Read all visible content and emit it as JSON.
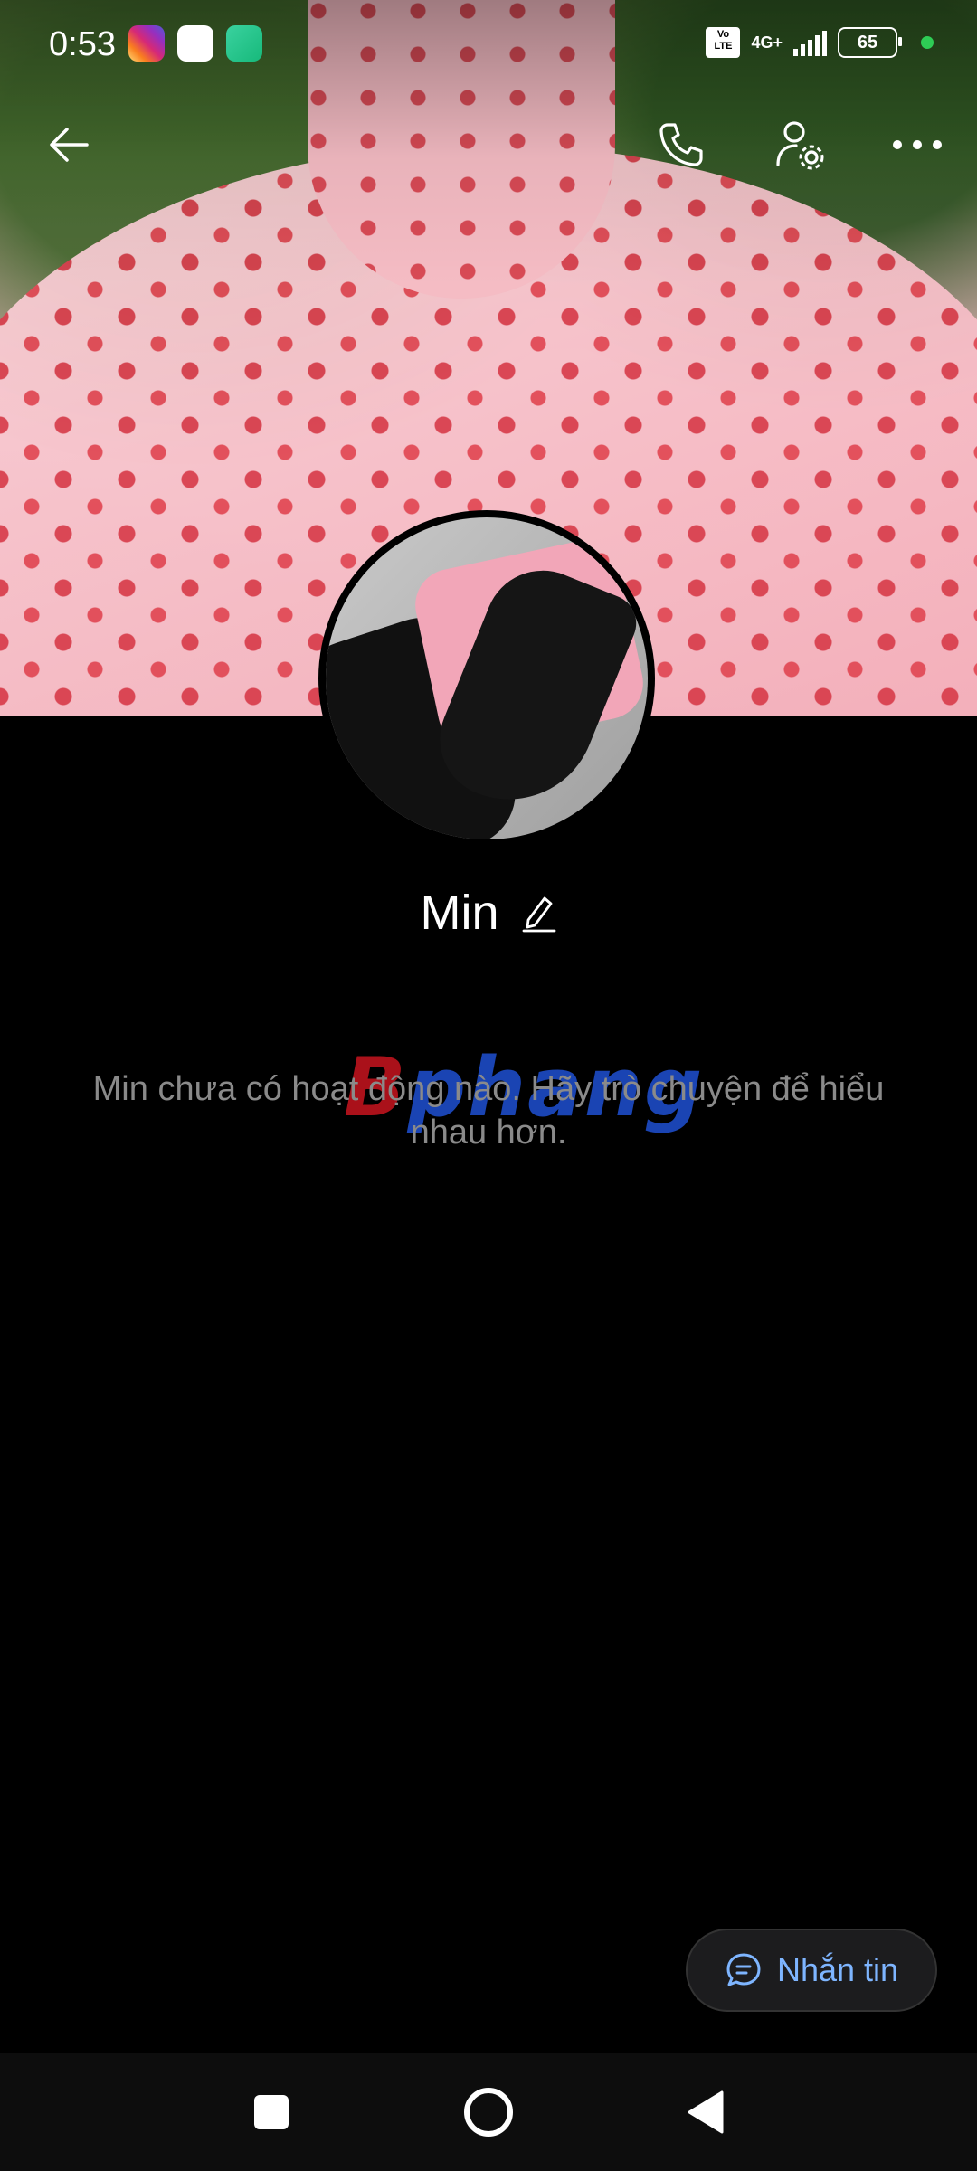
{
  "status_bar": {
    "time": "0:53",
    "network": "4G+",
    "volte": "Vo LTE",
    "battery": "65"
  },
  "profile": {
    "name": "Min",
    "empty_message": "Min chưa có hoạt động nào. Hãy trò chuyện để hiểu nhau hơn."
  },
  "watermark": {
    "text_red": "B",
    "text_blue": "phang"
  },
  "actions": {
    "message_label": "Nhắn tin"
  },
  "colors": {
    "accent": "#7eb5ff",
    "background": "#000000",
    "muted_text": "#8a8a8a"
  },
  "icons": [
    "back-arrow-icon",
    "phone-icon",
    "user-settings-icon",
    "more-icon",
    "edit-pencil-icon",
    "chat-bubble-icon",
    "recents-icon",
    "home-icon",
    "back-triangle-icon"
  ]
}
